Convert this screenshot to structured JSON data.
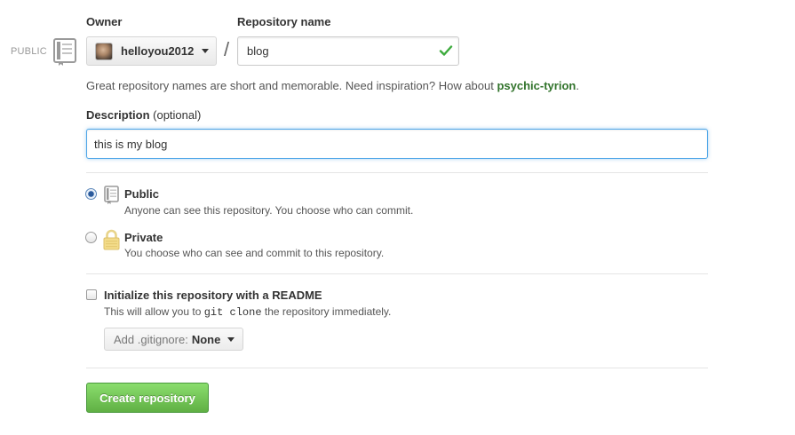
{
  "visibility_tag": "PUBLIC",
  "owner": {
    "label": "Owner",
    "name": "helloyou2012"
  },
  "separator": "/",
  "repository": {
    "label": "Repository name",
    "value": "blog",
    "valid": true
  },
  "hint": {
    "text": "Great repository names are short and memorable. Need inspiration? How about ",
    "suggestion": "psychic-tyrion",
    "suffix": "."
  },
  "description": {
    "label": "Description",
    "optional": "(optional)",
    "value": "this is my blog"
  },
  "visibility": {
    "selected": "public",
    "public": {
      "title": "Public",
      "desc": "Anyone can see this repository. You choose who can commit."
    },
    "private": {
      "title": "Private",
      "desc": "You choose who can see and commit to this repository."
    }
  },
  "readme": {
    "checked": false,
    "title": "Initialize this repository with a README",
    "desc_before": "This will allow you to ",
    "desc_code": "git clone",
    "desc_after": " the repository immediately."
  },
  "gitignore": {
    "label": "Add .gitignore:",
    "value": "None"
  },
  "create_button": "Create repository",
  "colors": {
    "suggestion": "#31732b",
    "create_button": "#60b044",
    "focus_border": "#51a7e8",
    "valid_check": "#3dab3d"
  }
}
